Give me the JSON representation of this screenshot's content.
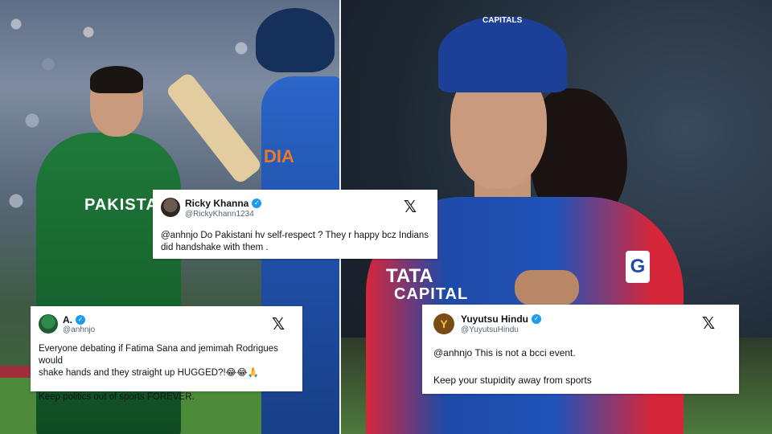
{
  "left_photo": {
    "pakistan_jersey_text": "PAKISTA",
    "india_jersey_text": "DIA"
  },
  "right_photo": {
    "jersey_sponsor_line1": "TATA",
    "jersey_sponsor_line2": "CAPITAL",
    "jersey_badge": "G",
    "cap_logo": "CAPITALS"
  },
  "tweets": [
    {
      "name": "Ricky Khanna",
      "handle": "@RickyKhann1234",
      "verified": true,
      "lines": [
        "@anhnjo Do Pakistani hv self-respect ? They r happy bcz Indians",
        "did handshake with them ."
      ]
    },
    {
      "name": "A.",
      "handle": "@anhnjo",
      "verified": true,
      "lines": [
        "Everyone debating if Fatima Sana and jemimah Rodrigues would",
        "shake hands and they straight up HUGGED?!😂😂🙏"
      ],
      "lines_after_gap": [
        "Keep politics out of sports FOREVER."
      ]
    },
    {
      "name": "Yuyutsu Hindu",
      "handle": "@YuyutsuHindu",
      "verified": true,
      "avatar_letter": "Y",
      "lines": [
        "@anhnjo This is not a bcci event."
      ],
      "lines_after_gap": [
        "Keep your stupidity away from sports"
      ]
    }
  ],
  "icons": {
    "x_logo": "𝕏",
    "verified_mark": "✓"
  },
  "colors": {
    "verified_blue": "#1d9bf0",
    "pakistan_green": "#1f7a3a",
    "india_blue": "#2b66c9",
    "capitals_red": "#d6263a"
  }
}
